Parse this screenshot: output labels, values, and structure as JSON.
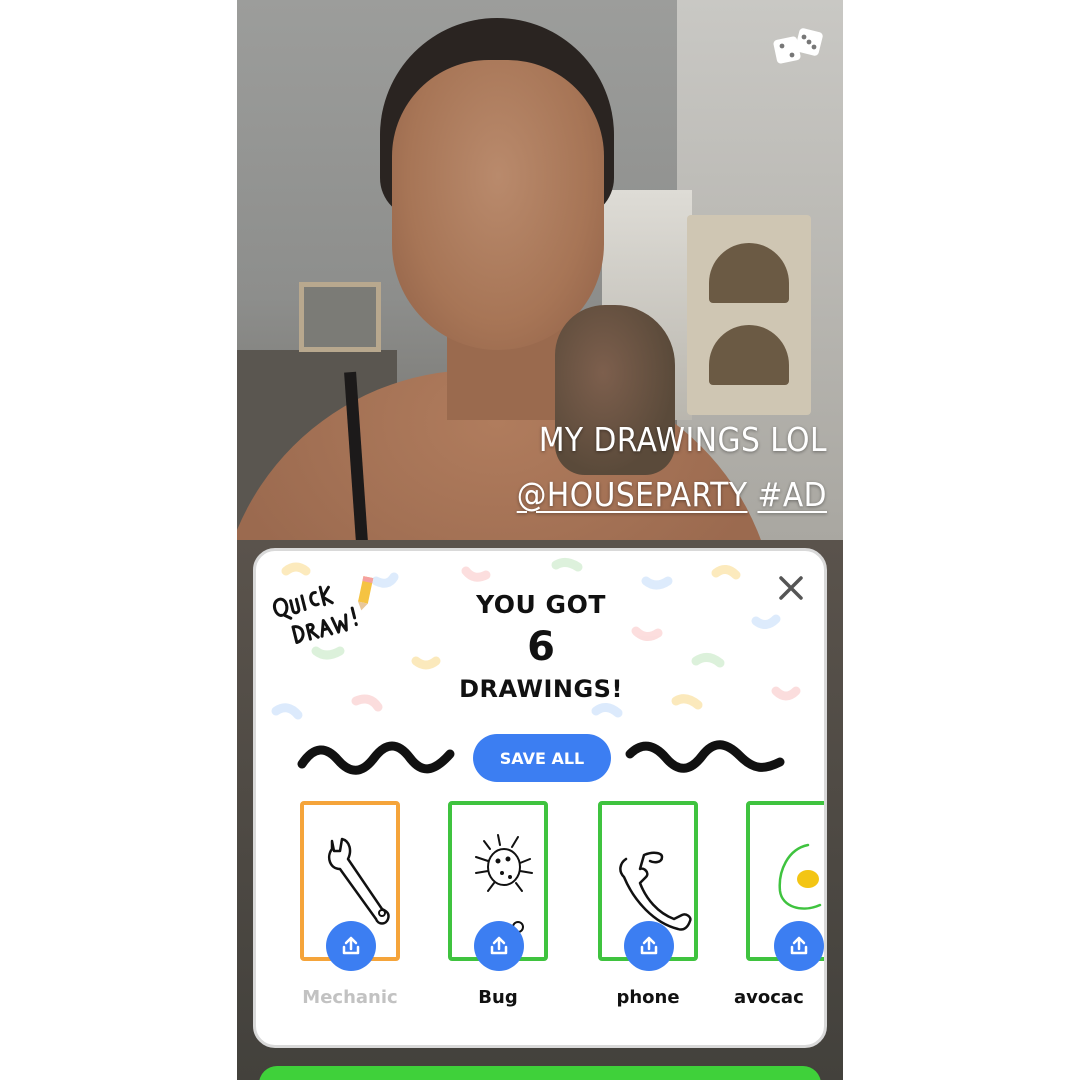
{
  "caption": {
    "line1": "MY DRAWINGS LOL",
    "mention": "@HOUSEPARTY",
    "hashtag": "#AD"
  },
  "game": {
    "logo_text": "Quick Draw!",
    "result_line1": "YOU GOT",
    "result_count": "6",
    "result_line3": "DRAWINGS!",
    "save_all_label": "SAVE ALL",
    "accent_color": "#3c7ef2",
    "correct_color": "#3fc33f",
    "missed_color": "#f5a43a",
    "drawings": [
      {
        "label": "Mechanic",
        "status": "missed",
        "icon": "wrench-sketch"
      },
      {
        "label": "Bug",
        "status": "correct",
        "icon": "bug-sketch"
      },
      {
        "label": "phone",
        "status": "correct",
        "icon": "phone-sketch"
      },
      {
        "label": "avocac",
        "status": "correct",
        "icon": "avocado-sketch"
      }
    ]
  }
}
